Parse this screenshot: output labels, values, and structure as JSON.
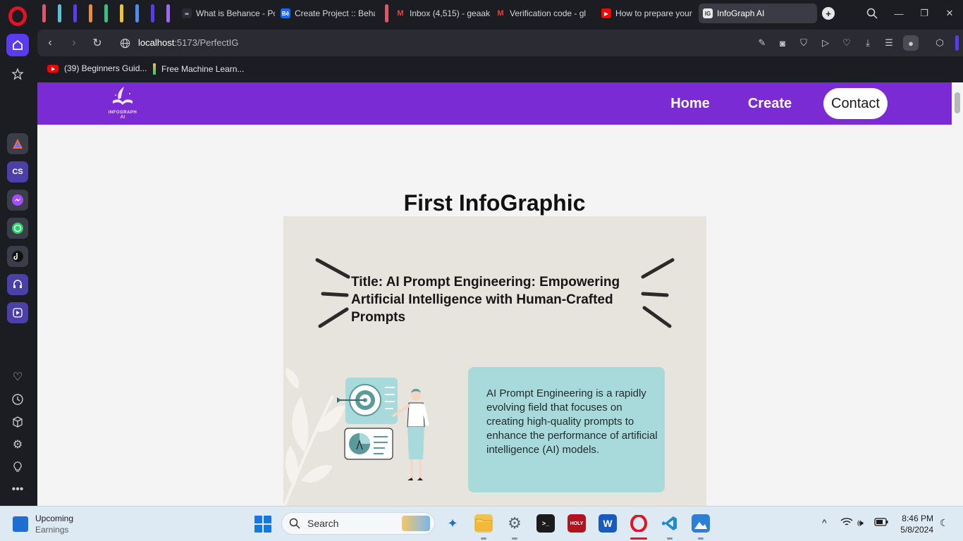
{
  "browser": {
    "tabs": [
      {
        "label": "What is Behance - Po",
        "favicon": "behance-icon"
      },
      {
        "label": "Create Project :: Beha",
        "favicon": "behance-icon"
      },
      {
        "label": "Inbox (4,515) - geaak",
        "favicon": "gmail-icon"
      },
      {
        "label": "Verification code - gl",
        "favicon": "gmail-icon"
      },
      {
        "label": "How to prepare your",
        "favicon": "youtube-icon"
      },
      {
        "label": "InfoGraph AI",
        "favicon": "site-icon",
        "active": true
      }
    ],
    "url_host": "localhost",
    "url_path": ":5173/PerfectIG",
    "bookmarks": [
      {
        "label": "(39) Beginners Guid...",
        "icon": "youtube-icon"
      },
      {
        "label": "Free Machine Learn...",
        "icon": "bookmark-icon"
      }
    ],
    "accent": "#5a3bf0"
  },
  "site": {
    "logo_text": "INFOGRAPH",
    "logo_sub": "AI",
    "nav": {
      "home": "Home",
      "create": "Create",
      "contact": "Contact"
    },
    "brand_color": "#7b2bd3"
  },
  "page": {
    "heading": "First InfoGraphic",
    "card": {
      "title": "Title: AI Prompt Engineering: Empowering Artificial Intelligence with Human-Crafted Prompts",
      "description": "AI Prompt Engineering is a rapidly evolving field that focuses on creating high-quality prompts to enhance the performance of artificial intelligence (AI) models.",
      "background": "#e7e3dd",
      "box_color": "#a8dadb"
    }
  },
  "taskbar": {
    "widget_title": "Upcoming",
    "widget_sub": "Earnings",
    "search_placeholder": "Search",
    "time": "8:46 PM",
    "date": "5/8/2024"
  }
}
